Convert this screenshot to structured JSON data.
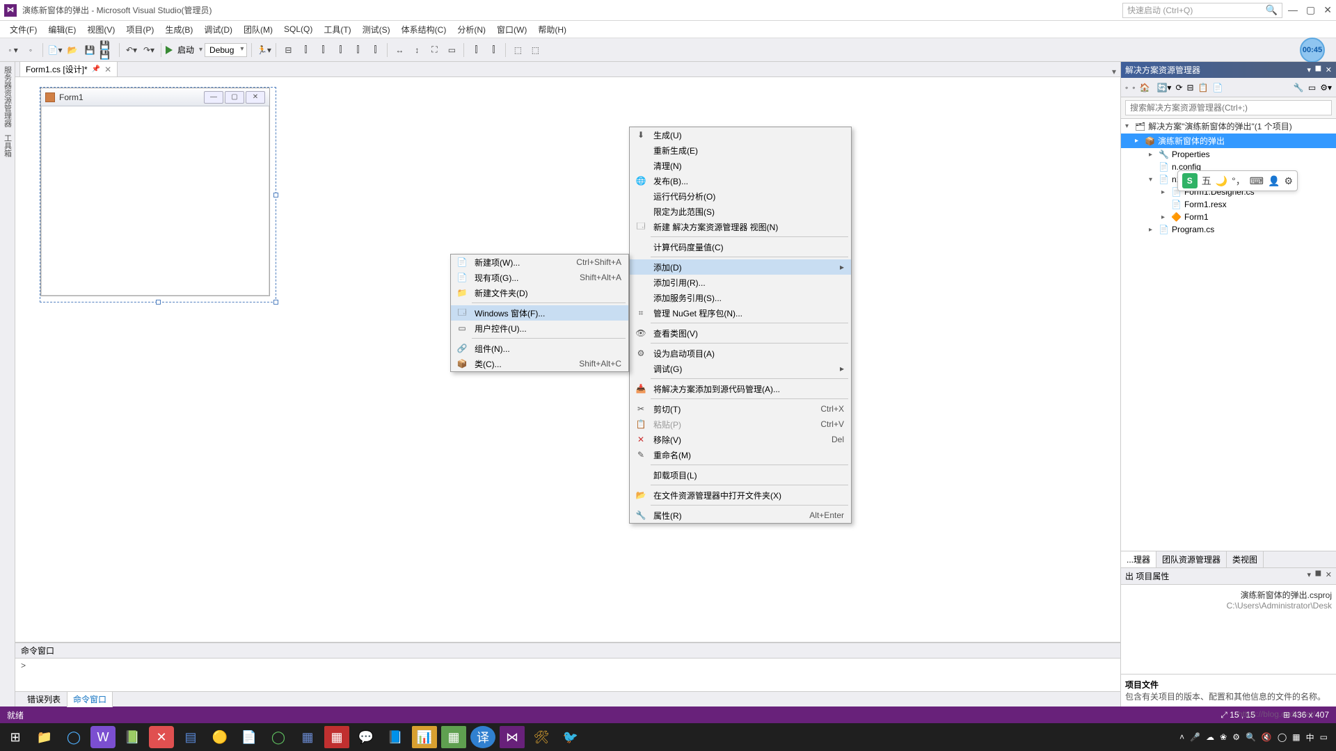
{
  "title": "演练新窗体的弹出 - Microsoft Visual Studio(管理员)",
  "quickLaunch": "快速启动 (Ctrl+Q)",
  "menu": [
    "文件(F)",
    "编辑(E)",
    "视图(V)",
    "项目(P)",
    "生成(B)",
    "调试(D)",
    "团队(M)",
    "SQL(Q)",
    "工具(T)",
    "测试(S)",
    "体系结构(C)",
    "分析(N)",
    "窗口(W)",
    "帮助(H)"
  ],
  "toolbar": {
    "start": "启动",
    "config": "Debug"
  },
  "timer": "00:45",
  "tab": {
    "name": "Form1.cs [设计]*"
  },
  "leftRail": {
    "a": "服务器资源管理器",
    "b": "工具箱"
  },
  "formDesigner": {
    "title": "Form1"
  },
  "solution": {
    "panelTitle": "解决方案资源管理器",
    "searchPlaceholder": "搜索解决方案资源管理器(Ctrl+;)",
    "root": "解决方案\"演练新窗体的弹出\"(1 个项目)",
    "project": "演练新窗体的弹出",
    "nodes": {
      "properties": "Properties",
      "config": "n.config",
      "form1cs": "n1.cs",
      "designer": "Form1.Designer.cs",
      "resx": "Form1.resx",
      "form1": "Form1",
      "program": "Program.cs"
    },
    "tabs": [
      "...理器",
      "团队资源管理器",
      "类视图"
    ]
  },
  "propsPanel": {
    "t0": "出",
    "title": "项目属性",
    "filename": "演练新窗体的弹出.csproj",
    "filepath": "C:\\Users\\Administrator\\Desk",
    "footerTitle": "项目文件",
    "footerDesc": "包含有关项目的版本、配置和其他信息的文件的名称。"
  },
  "cmdWindow": {
    "title": "命令窗口",
    "body": ">"
  },
  "bottomTabs": {
    "errors": "错误列表",
    "cmd": "命令窗口"
  },
  "status": {
    "ready": "就绪",
    "pos": "15 , 15",
    "size": "436 x 407"
  },
  "ctxMain": [
    {
      "icon": "⬇",
      "label": "生成(U)"
    },
    {
      "label": "重新生成(E)"
    },
    {
      "label": "清理(N)"
    },
    {
      "icon": "🌐",
      "label": "发布(B)..."
    },
    {
      "label": "运行代码分析(O)"
    },
    {
      "label": "限定为此范围(S)"
    },
    {
      "icon": "🗔",
      "label": "新建 解决方案资源管理器 视图(N)"
    },
    {
      "sep": true
    },
    {
      "label": "计算代码度量值(C)"
    },
    {
      "sep": true
    },
    {
      "label": "添加(D)",
      "sub": true,
      "hl": true
    },
    {
      "label": "添加引用(R)..."
    },
    {
      "label": "添加服务引用(S)..."
    },
    {
      "icon": "⌗",
      "label": "管理 NuGet 程序包(N)..."
    },
    {
      "sep": true
    },
    {
      "icon": "👁",
      "label": "查看类图(V)"
    },
    {
      "sep": true
    },
    {
      "icon": "⚙",
      "label": "设为启动项目(A)"
    },
    {
      "label": "调试(G)",
      "sub": true
    },
    {
      "sep": true
    },
    {
      "icon": "📥",
      "label": "将解决方案添加到源代码管理(A)..."
    },
    {
      "sep": true
    },
    {
      "icon": "✂",
      "label": "剪切(T)",
      "short": "Ctrl+X"
    },
    {
      "icon": "📋",
      "label": "粘贴(P)",
      "short": "Ctrl+V",
      "dis": true
    },
    {
      "icon": "✕",
      "label": "移除(V)",
      "short": "Del",
      "iconColor": "#c33"
    },
    {
      "icon": "✎",
      "label": "重命名(M)"
    },
    {
      "sep": true
    },
    {
      "label": "卸载项目(L)"
    },
    {
      "sep": true
    },
    {
      "icon": "📂",
      "label": "在文件资源管理器中打开文件夹(X)"
    },
    {
      "sep": true
    },
    {
      "icon": "🔧",
      "label": "属性(R)",
      "short": "Alt+Enter"
    }
  ],
  "ctxSub": [
    {
      "icon": "📄",
      "label": "新建项(W)...",
      "short": "Ctrl+Shift+A"
    },
    {
      "icon": "📄",
      "label": "现有项(G)...",
      "short": "Shift+Alt+A"
    },
    {
      "icon": "📁",
      "label": "新建文件夹(D)"
    },
    {
      "sep": true
    },
    {
      "icon": "🗔",
      "label": "Windows 窗体(F)...",
      "hl": true
    },
    {
      "icon": "▭",
      "label": "用户控件(U)..."
    },
    {
      "sep": true
    },
    {
      "icon": "🔗",
      "label": "组件(N)..."
    },
    {
      "icon": "📦",
      "label": "类(C)...",
      "short": "Shift+Alt+C"
    }
  ],
  "ime": {
    "text": "五"
  },
  "watermark": "https://blog.csdn.net/..."
}
